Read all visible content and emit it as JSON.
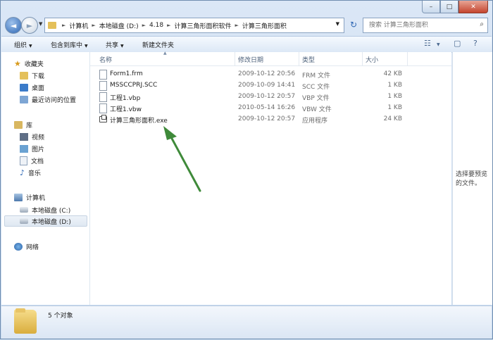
{
  "window": {
    "caption": {
      "minimize": "–",
      "maximize": "□",
      "close": "✕"
    },
    "nav": {
      "back_glyph": "◄",
      "forward_glyph": "►",
      "dropdown_glyph": "▼"
    },
    "breadcrumbs": [
      "计算机",
      "本地磁盘 (D:)",
      "4.18",
      "计算三角形面积软件",
      "计算三角形面积"
    ],
    "breadcrumb_separator": "►",
    "address_dropdown": "▼",
    "refresh_glyph": "↻",
    "search": {
      "placeholder": "搜索 计算三角形面积",
      "icon_glyph": "⌕"
    }
  },
  "toolbar": {
    "organize": "组织",
    "include_in_library": "包含到库中",
    "share": "共享",
    "new_folder": "新建文件夹",
    "dropdown_glyph": "▼",
    "view_glyph": "☷",
    "view_dropdown": "▼",
    "preview_glyph": "▢",
    "help_glyph": "?"
  },
  "sidebar": {
    "favorites": {
      "label": "收藏夹",
      "icon_glyph": "★"
    },
    "favorites_items": [
      "下载",
      "桌面",
      "最近访问的位置"
    ],
    "libraries": {
      "label": "库"
    },
    "library_items": [
      "视频",
      "图片",
      "文档",
      "音乐"
    ],
    "music_glyph": "♪",
    "computer": {
      "label": "计算机"
    },
    "computer_items": [
      "本地磁盘 (C:)",
      "本地磁盘 (D:)"
    ],
    "network": {
      "label": "网络"
    }
  },
  "columns": {
    "name": "名称",
    "modified": "修改日期",
    "type": "类型",
    "size": "大小",
    "sort_glyph": "▲"
  },
  "files": [
    {
      "name": "Form1.frm",
      "modified": "2009-10-12 20:56",
      "type": "FRM 文件",
      "size": "42 KB"
    },
    {
      "name": "MSSCCPRJ.SCC",
      "modified": "2009-10-09 14:41",
      "type": "SCC 文件",
      "size": "1 KB"
    },
    {
      "name": "工程1.vbp",
      "modified": "2009-10-12 20:57",
      "type": "VBP 文件",
      "size": "1 KB"
    },
    {
      "name": "工程1.vbw",
      "modified": "2010-05-14 16:26",
      "type": "VBW 文件",
      "size": "1 KB"
    },
    {
      "name": "计算三角形面积.exe",
      "modified": "2009-10-12 20:57",
      "type": "应用程序",
      "size": "24 KB"
    }
  ],
  "preview": {
    "text": "选择要预览的文件。"
  },
  "status": {
    "count": "5 个对象"
  },
  "colors": {
    "annotation_arrow": "#3f8a3a"
  }
}
